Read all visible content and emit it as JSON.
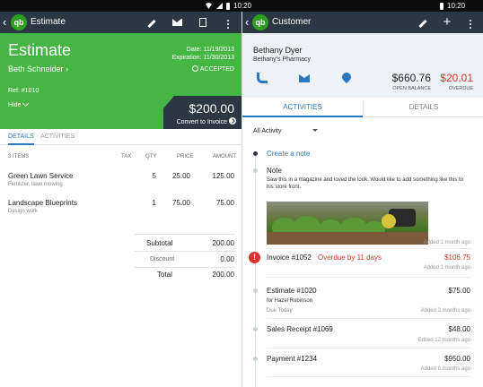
{
  "status_bar": {
    "time_left": "10:20",
    "time_right": "10:20"
  },
  "estimate_screen": {
    "app_bar": {
      "back_icon": "back-arrow-icon",
      "logo": "qb",
      "title": "Estimate",
      "actions": [
        "pencil-icon",
        "mail-icon",
        "document-icon",
        "overflow-menu-icon"
      ]
    },
    "header": {
      "title": "Estimate",
      "date": "Date: 11/19/2013",
      "expiration": "Expiration: 11/30/2013",
      "customer": "Beth Schneider",
      "status": "ACCEPTED",
      "ref": "Ref: #1010",
      "hide": "Hide",
      "total": "$200.00",
      "convert": "Convert to Invoice",
      "accent_color": "#45b543"
    },
    "tabs": [
      "DETAILS",
      "ACTIVITIES"
    ],
    "columns": {
      "items": "3 ITEMS",
      "tax": "TAX",
      "qty": "QTY",
      "price": "PRICE",
      "amount": "AMOUNT"
    },
    "items": [
      {
        "name": "Green Lawn Service",
        "desc": "Fertilizer, lawn mowing",
        "qty": "5",
        "price": "25.00",
        "amount": "125.00"
      },
      {
        "name": "Landscape Blueprints",
        "desc": "Design work",
        "qty": "1",
        "price": "75.00",
        "amount": "75.00"
      }
    ],
    "totals": {
      "subtotal_label": "Subtotal",
      "subtotal": "200.00",
      "discount_label": "Discount",
      "discount": "0.00",
      "total_label": "Total",
      "total": "200.00"
    }
  },
  "customer_screen": {
    "app_bar": {
      "back_icon": "back-arrow-icon",
      "logo": "qb",
      "title": "Customer",
      "actions": [
        "pencil-icon",
        "plus-icon",
        "overflow-menu-icon"
      ]
    },
    "header": {
      "name": "Bethany Dyer",
      "company": "Bethany's Pharmacy",
      "open_balance": "$660.76",
      "open_balance_label": "OPEN BALANCE",
      "overdue": "$20.01",
      "overdue_label": "OVERDUE",
      "overdue_color": "#d9342b"
    },
    "tabs": [
      "ACTIVITIES",
      "DETAILS"
    ],
    "filter": "All Activity",
    "activities": {
      "create_note": "Create a note",
      "note": {
        "title": "Note",
        "body": "Saw this in a magazine and loved the look. Would like to add something like this to his store front.",
        "meta": "Added 1 month ago"
      },
      "invoice": {
        "title": "Invoice #1052",
        "status": "Overdue by 11 days",
        "amount": "$106.75",
        "meta": "Added 1 month ago"
      },
      "estimate": {
        "title": "Estimate #1020",
        "amount": "$75.00",
        "for": "for Hazel Robinson",
        "due": "Due Today",
        "meta": "Added 3 months ago"
      },
      "sales_receipt": {
        "title": "Sales Receipt #1069",
        "amount": "$48.00",
        "meta": "Edited 12 months ago"
      },
      "payment": {
        "title": "Payment #1234",
        "amount": "$950.00",
        "meta": "Added 8 months ago"
      }
    }
  }
}
